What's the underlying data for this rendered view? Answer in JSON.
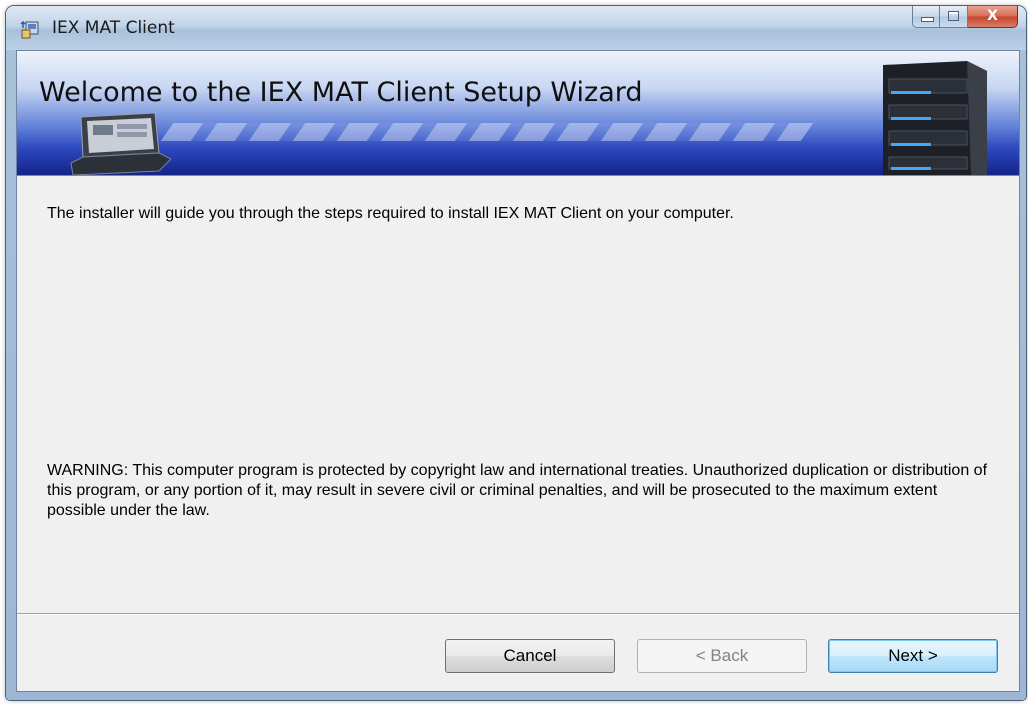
{
  "window": {
    "title": "IEX MAT Client"
  },
  "caption_buttons": {
    "minimize_icon": "minimize-icon",
    "maximize_icon": "maximize-icon",
    "close_icon": "close-icon",
    "close_glyph": "X"
  },
  "banner": {
    "title": "Welcome to the IEX MAT Client Setup Wizard"
  },
  "body": {
    "intro": "The installer will guide you through the steps required to install IEX MAT Client on your computer.",
    "warning": "WARNING: This computer program is protected by copyright law and international treaties. Unauthorized duplication or distribution of this program, or any portion of it, may result in severe civil or criminal penalties, and will be prosecuted to the maximum extent possible under the law."
  },
  "buttons": {
    "cancel": "Cancel",
    "back": "< Back",
    "next": "Next >",
    "back_enabled": false
  },
  "colors": {
    "banner_blue": "#2e49bf",
    "client_bg": "#f0f0f0",
    "close_red": "#c6452b",
    "default_button_border": "#3c7fb1"
  }
}
